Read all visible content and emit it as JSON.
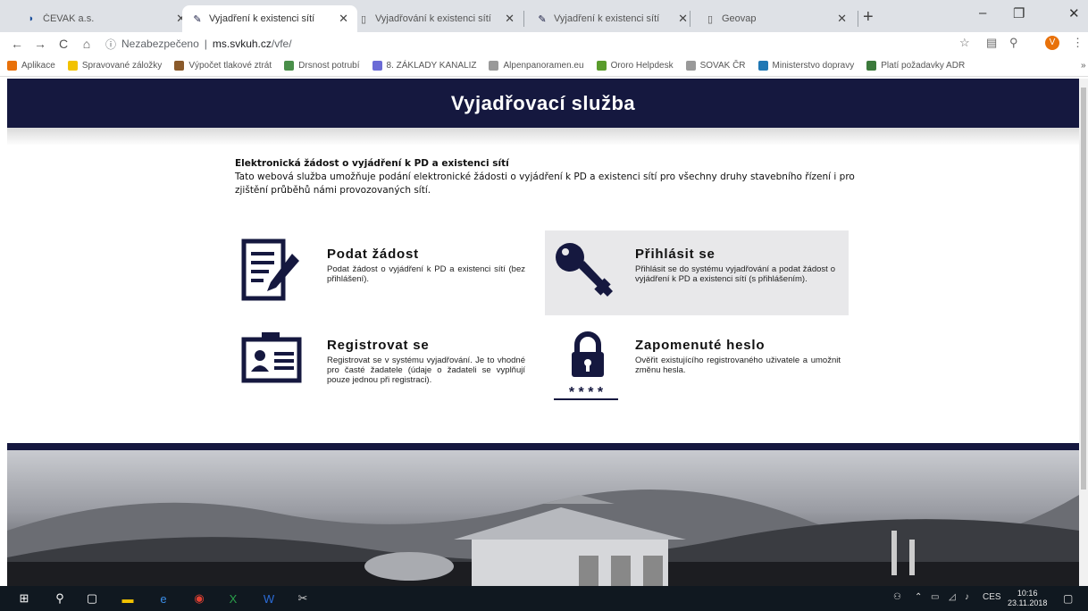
{
  "browser": {
    "tabs": [
      {
        "title": "ČEVAK a.s.",
        "icon": "cevak-favicon",
        "active": false
      },
      {
        "title": "Vyjadření k existenci sítí",
        "icon": "document-edit-favicon",
        "active": true
      },
      {
        "title": "Vyjadřování k existenci sítí",
        "icon": "page-favicon",
        "active": false
      },
      {
        "title": "Vyjadření k existenci sítí",
        "icon": "document-edit-favicon",
        "active": false
      },
      {
        "title": "Geovap",
        "icon": "page-favicon",
        "active": false
      }
    ],
    "new_tab": "+",
    "window_controls": {
      "minimize": "–",
      "maximize": "❐",
      "close": "✕"
    },
    "nav": {
      "back": "←",
      "forward": "→",
      "reload": "C",
      "home": "⌂"
    },
    "address": {
      "security": "Nezabezpečeno",
      "separator": "|",
      "host": "ms.svkuh.cz",
      "path": "/vfe/"
    },
    "avatar_letter": "V",
    "bookmarks": [
      {
        "label": "Aplikace",
        "icon_color": "#e8710a"
      },
      {
        "label": "Spravované záložky",
        "icon_color": "#f2c200"
      },
      {
        "label": "Výpočet tlakové ztrát",
        "icon_color": "#8a5a2b"
      },
      {
        "label": "Drsnost potrubí",
        "icon_color": "#4a8f4a"
      },
      {
        "label": "8. ZÁKLADY KANALIZ",
        "icon_color": "#6b6bd6"
      },
      {
        "label": "Alpenpanoramen.eu",
        "icon_color": "#999999"
      },
      {
        "label": "Ororo Helpdesk",
        "icon_color": "#5a9c2c"
      },
      {
        "label": "SOVAK ČR",
        "icon_color": "#999999"
      },
      {
        "label": "Ministerstvo dopravy",
        "icon_color": "#1f77b4"
      },
      {
        "label": "Platí požadavky ADR",
        "icon_color": "#3c7a3c"
      }
    ],
    "bookmarks_more": "»"
  },
  "page": {
    "header_title": "Vyjadřovací služba",
    "intro": {
      "title": "Elektronická žádost o vyjádření k PD a existenci sítí",
      "text": "Tato webová služba umožňuje podání elektronické žádosti o vyjádření k PD a existenci sítí pro všechny druhy stavebního řízení i pro zjištění průběhů námi provozovaných sítí."
    },
    "tiles": [
      {
        "title": "Podat žádost",
        "desc": "Podat žádost o vyjádření k PD a existenci sítí (bez přihlášení).",
        "icon": "form-edit-icon"
      },
      {
        "title": "Přihlásit se",
        "desc": "Přihlásit se do systému vyjadřování a podat žádost o vyjádření k PD a existenci sítí (s přihlášením).",
        "icon": "key-icon"
      },
      {
        "title": "Registrovat se",
        "desc": "Registrovat se v systému vyjadřování. Je to vhodné pro časté žadatele (údaje o žadateli se vyplňují pouze jednou při registraci).",
        "icon": "id-card-icon"
      },
      {
        "title": "Zapomenuté heslo",
        "desc": "Ověřit existujícího registrovaného uživatele a umožnit změnu hesla.",
        "icon": "padlock-password-icon"
      }
    ],
    "password_mask": "* * * *"
  },
  "taskbar": {
    "items": [
      "windows-start-icon",
      "search-icon",
      "task-view-icon",
      "file-explorer-icon",
      "edge-icon",
      "chrome-icon",
      "excel-icon",
      "word-icon",
      "snipping-icon"
    ],
    "language": "CES",
    "time": "10:16",
    "date": "23.11.2018"
  },
  "colors": {
    "header_bg": "#15183f",
    "tile_highlight": "#e8e8ea"
  }
}
